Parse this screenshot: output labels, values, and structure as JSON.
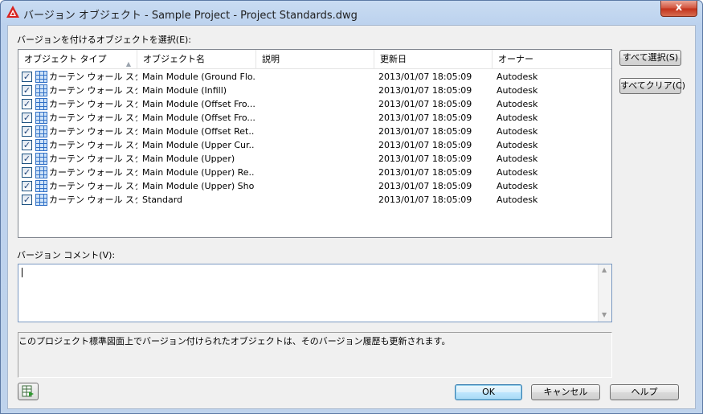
{
  "window": {
    "title": "バージョン オブジェクト - Sample Project - Project Standards.dwg",
    "close_label": "x"
  },
  "labels": {
    "select_objects": "バージョンを付けるオブジェクトを選択(E):",
    "version_comment": "バージョン コメント(V):",
    "info": "このプロジェクト標準図面上でバージョン付けられたオブジェクトは、そのバージョン履歴も更新されます。"
  },
  "list": {
    "columns": [
      {
        "label": "オブジェクト タイプ"
      },
      {
        "label": "オブジェクト名"
      },
      {
        "label": "説明"
      },
      {
        "label": "更新日"
      },
      {
        "label": "オーナー"
      }
    ],
    "rows": [
      {
        "checked": true,
        "type": "カーテン ウォール スタ...",
        "name": "Main Module (Ground Flo...",
        "description": "",
        "date": "2013/01/07 18:05:09",
        "owner": "Autodesk"
      },
      {
        "checked": true,
        "type": "カーテン ウォール スタ...",
        "name": "Main Module (Infill)",
        "description": "",
        "date": "2013/01/07 18:05:09",
        "owner": "Autodesk"
      },
      {
        "checked": true,
        "type": "カーテン ウォール スタ...",
        "name": "Main Module (Offset Fro...",
        "description": "",
        "date": "2013/01/07 18:05:09",
        "owner": "Autodesk"
      },
      {
        "checked": true,
        "type": "カーテン ウォール スタ...",
        "name": "Main Module (Offset Fro...",
        "description": "",
        "date": "2013/01/07 18:05:09",
        "owner": "Autodesk"
      },
      {
        "checked": true,
        "type": "カーテン ウォール スタ...",
        "name": "Main Module (Offset Ret...",
        "description": "",
        "date": "2013/01/07 18:05:09",
        "owner": "Autodesk"
      },
      {
        "checked": true,
        "type": "カーテン ウォール スタ...",
        "name": "Main Module (Upper Cur...",
        "description": "",
        "date": "2013/01/07 18:05:09",
        "owner": "Autodesk"
      },
      {
        "checked": true,
        "type": "カーテン ウォール スタ...",
        "name": "Main Module (Upper)",
        "description": "",
        "date": "2013/01/07 18:05:09",
        "owner": "Autodesk"
      },
      {
        "checked": true,
        "type": "カーテン ウォール スタ...",
        "name": "Main Module (Upper) Re...",
        "description": "",
        "date": "2013/01/07 18:05:09",
        "owner": "Autodesk"
      },
      {
        "checked": true,
        "type": "カーテン ウォール スタ...",
        "name": "Main Module (Upper) Sho...",
        "description": "",
        "date": "2013/01/07 18:05:09",
        "owner": "Autodesk"
      },
      {
        "checked": true,
        "type": "カーテン ウォール スタ...",
        "name": "Standard",
        "description": "",
        "date": "2013/01/07 18:05:09",
        "owner": "Autodesk"
      }
    ]
  },
  "buttons": {
    "select_all": "すべて選択(S)",
    "clear_all": "すべてクリア(C)",
    "ok": "OK",
    "cancel": "キャンセル",
    "help": "ヘルプ"
  },
  "comment": {
    "value": ""
  },
  "icons": {
    "app": "autocad-logo-icon",
    "row": "curtain-wall-grid-icon",
    "check": "checkbox-checked-icon",
    "sort": "sort-ascending-icon",
    "footer": "export-table-icon"
  },
  "colors": {
    "title_bg": "#bcd2ee",
    "client_bg": "#f0f0f0",
    "close_red": "#c2311a",
    "grid_blue": "#2f6fc6"
  }
}
